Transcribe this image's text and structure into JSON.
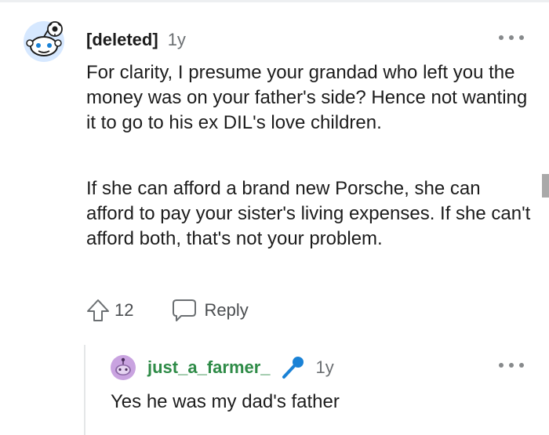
{
  "comment": {
    "author": "[deleted]",
    "age": "1y",
    "avatar_icon": "snoo-avatar-icon",
    "paragraphs": [
      "For clarity, I presume your grandad who left you the money was on your father's side? Hence not wanting it to go to his ex DIL's love children.",
      "If she can afford a brand new Porsche, she can afford to pay your sister's living expenses. If she can't afford both, that's not your problem."
    ],
    "upvotes": "12",
    "reply_label": "Reply"
  },
  "reply": {
    "author": "just_a_farmer_",
    "age": "1y",
    "avatar_icon": "snoo-avatar-icon",
    "badge_icon": "microphone-icon",
    "text": "Yes he was my dad's father"
  },
  "colors": {
    "reply_username": "#2e8b47",
    "badge": "#1a82d6",
    "reply_avatar": "#c9a3e0"
  }
}
